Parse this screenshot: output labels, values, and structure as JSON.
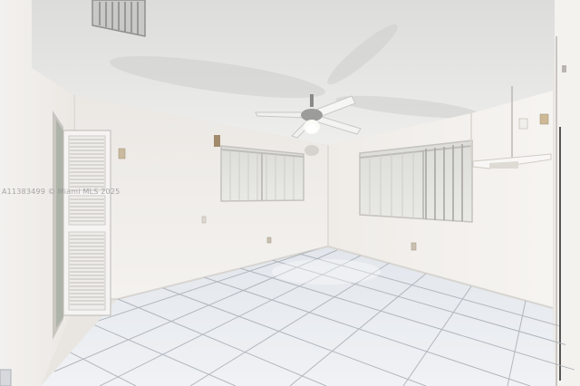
{
  "photo": {
    "watermark": "A11383499 © Miami MLS 2025"
  }
}
